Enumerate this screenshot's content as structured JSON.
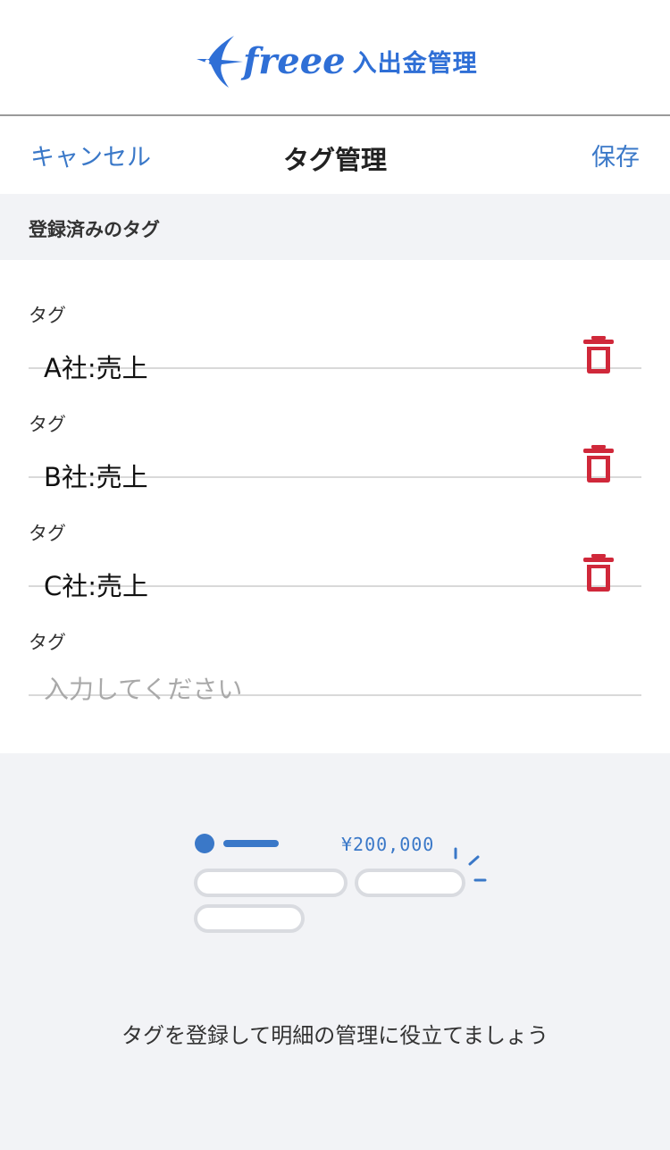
{
  "brand": {
    "name": "freee",
    "product": "入出金管理",
    "color": "#2f6fd6",
    "icon": "swallow-logo-icon"
  },
  "navbar": {
    "cancel_label": "キャンセル",
    "title": "タグ管理",
    "save_label": "保存",
    "link_color": "#3a78c8"
  },
  "section": {
    "title": "登録済みのタグ"
  },
  "tags": [
    {
      "label": "タグ",
      "value": "A社:売上",
      "icon": "trash-icon"
    },
    {
      "label": "タグ",
      "value": "B社:売上",
      "icon": "trash-icon"
    },
    {
      "label": "タグ",
      "value": "C社:売上",
      "icon": "trash-icon"
    }
  ],
  "new_tag": {
    "label": "タグ",
    "value": "",
    "placeholder": "入力してください"
  },
  "empty_state": {
    "amount": "¥200,000",
    "message": "タグを登録して明細の管理に役立てましょう"
  },
  "colors": {
    "delete": "#d0283a",
    "background": "#f2f3f6"
  }
}
